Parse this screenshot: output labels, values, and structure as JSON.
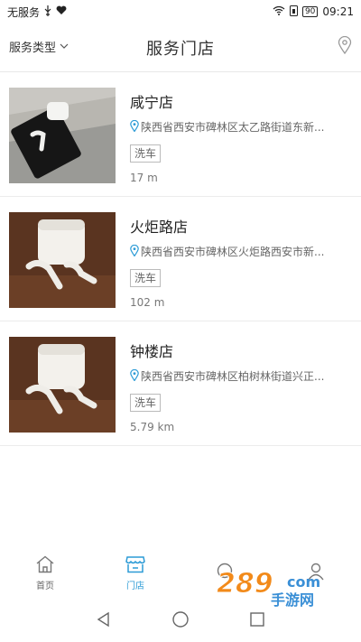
{
  "status_bar": {
    "carrier": "无服务",
    "battery": "90",
    "time": "09:21"
  },
  "header": {
    "filter_label": "服务类型",
    "title": "服务门店"
  },
  "stores": [
    {
      "name": "咸宁店",
      "address": "陕西省西安市碑林区太乙路街道东新...",
      "tag": "洗车",
      "distance": "17 m"
    },
    {
      "name": "火炬路店",
      "address": "陕西省西安市碑林区火炬路西安市新...",
      "tag": "洗车",
      "distance": "102 m"
    },
    {
      "name": "钟楼店",
      "address": "陕西省西安市碑林区柏树林街道兴正...",
      "tag": "洗车",
      "distance": "5.79 km"
    }
  ],
  "tabs": [
    {
      "label": "首页",
      "icon": "home-icon"
    },
    {
      "label": "门店",
      "icon": "store-icon"
    },
    {
      "label": "",
      "icon": "search-icon"
    },
    {
      "label": "",
      "icon": "user-icon"
    }
  ],
  "colors": {
    "accent": "#2c9bd6",
    "tag_border": "#bbbbbb",
    "divider": "#ececec"
  },
  "watermark": {
    "text": "289",
    "domain": "com",
    "caption": "手游网"
  }
}
